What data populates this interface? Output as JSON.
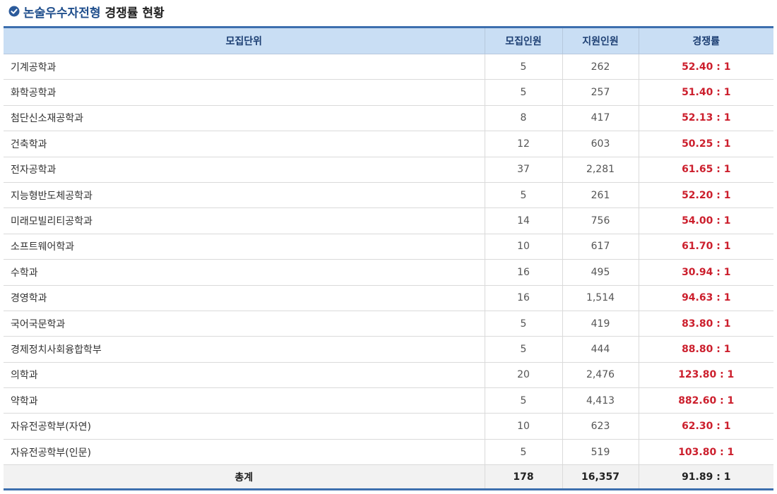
{
  "heading": {
    "accent": "논술우수자전형",
    "rest": "경쟁률 현황"
  },
  "table": {
    "headers": [
      "모집단위",
      "모집인원",
      "지원인원",
      "경쟁률"
    ],
    "rows": [
      {
        "unit": "기계공학과",
        "quota": "5",
        "applicants": "262",
        "rate": "52.40 : 1"
      },
      {
        "unit": "화학공학과",
        "quota": "5",
        "applicants": "257",
        "rate": "51.40 : 1"
      },
      {
        "unit": "첨단신소재공학과",
        "quota": "8",
        "applicants": "417",
        "rate": "52.13 : 1"
      },
      {
        "unit": "건축학과",
        "quota": "12",
        "applicants": "603",
        "rate": "50.25 : 1"
      },
      {
        "unit": "전자공학과",
        "quota": "37",
        "applicants": "2,281",
        "rate": "61.65 : 1"
      },
      {
        "unit": "지능형반도체공학과",
        "quota": "5",
        "applicants": "261",
        "rate": "52.20 : 1"
      },
      {
        "unit": "미래모빌리티공학과",
        "quota": "14",
        "applicants": "756",
        "rate": "54.00 : 1"
      },
      {
        "unit": "소프트웨어학과",
        "quota": "10",
        "applicants": "617",
        "rate": "61.70 : 1"
      },
      {
        "unit": "수학과",
        "quota": "16",
        "applicants": "495",
        "rate": "30.94 : 1"
      },
      {
        "unit": "경영학과",
        "quota": "16",
        "applicants": "1,514",
        "rate": "94.63 : 1"
      },
      {
        "unit": "국어국문학과",
        "quota": "5",
        "applicants": "419",
        "rate": "83.80 : 1"
      },
      {
        "unit": "경제정치사회융합학부",
        "quota": "5",
        "applicants": "444",
        "rate": "88.80 : 1"
      },
      {
        "unit": "의학과",
        "quota": "20",
        "applicants": "2,476",
        "rate": "123.80 : 1"
      },
      {
        "unit": "약학과",
        "quota": "5",
        "applicants": "4,413",
        "rate": "882.60 : 1"
      },
      {
        "unit": "자유전공학부(자연)",
        "quota": "10",
        "applicants": "623",
        "rate": "62.30 : 1"
      },
      {
        "unit": "자유전공학부(인문)",
        "quota": "5",
        "applicants": "519",
        "rate": "103.80 : 1"
      }
    ],
    "total": {
      "label": "총계",
      "quota": "178",
      "applicants": "16,357",
      "rate": "91.89 : 1"
    }
  },
  "colors": {
    "accent": "#1f4e8c",
    "header_bg": "#c9def4",
    "border_accent": "#3d6fae",
    "rate_red": "#cc1f2d",
    "total_bg": "#f2f2f2"
  },
  "icons": {
    "heading_icon": "check-circle-icon"
  }
}
